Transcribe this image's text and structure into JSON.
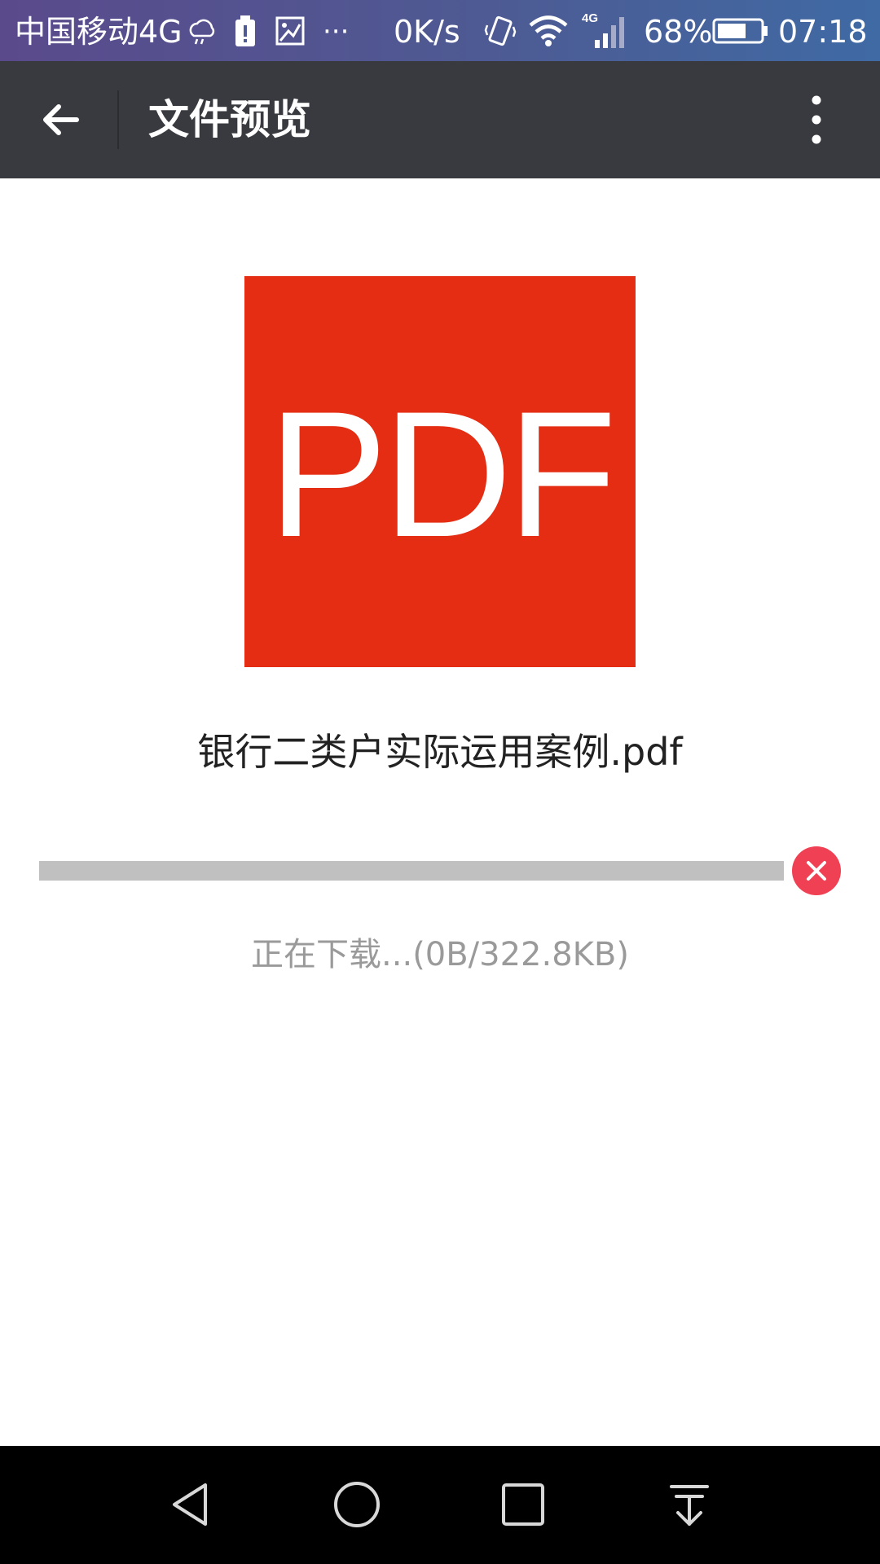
{
  "status_bar": {
    "carrier": "中国移动4G",
    "network_speed": "0K/s",
    "network_type": "4G",
    "battery_percent": "68%",
    "battery_level": 0.68,
    "time": "07:18",
    "overflow": "···",
    "icons": [
      "weather-icon",
      "battery-alert-icon",
      "image-icon",
      "vibrate-icon",
      "wifi-icon",
      "signal-icon",
      "battery-icon"
    ]
  },
  "app_bar": {
    "title": "文件预览",
    "back_icon": "arrow-left-icon",
    "more_icon": "more-vertical-icon",
    "background": "#393a3f"
  },
  "file": {
    "type_label": "PDF",
    "name": "银行二类户实际运用案例.pdf",
    "icon_color": "#e42d13"
  },
  "download": {
    "status_text": "正在下载...(0B/322.8KB)",
    "progress": 0,
    "cancel_icon": "close-circle-icon",
    "cancel_color": "#f04053"
  },
  "nav_bar": {
    "buttons": [
      "back-triangle-icon",
      "home-circle-icon",
      "recents-square-icon",
      "notification-pulldown-icon"
    ]
  }
}
